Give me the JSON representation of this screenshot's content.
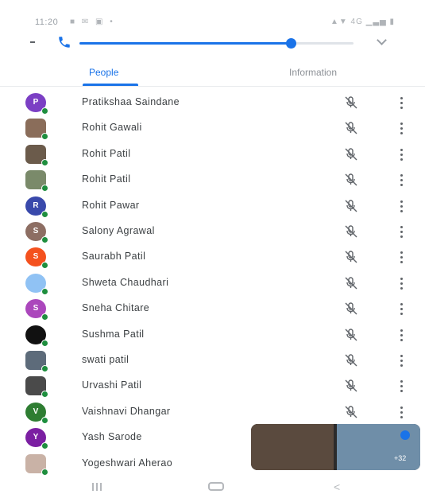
{
  "status_bar": {
    "time": "11:20",
    "left_icons": "■ ✉ ▣ •",
    "right": "▲▼ 4G ▁▃▅ ▮"
  },
  "call": {
    "progress": 0.77
  },
  "tabs": [
    {
      "label": "People",
      "active": true
    },
    {
      "label": "Information",
      "active": false
    }
  ],
  "participants": [
    {
      "name": "Pratikshaa Saindane",
      "avatar": {
        "type": "initial",
        "letter": "P",
        "color": "#7b3fc4"
      }
    },
    {
      "name": "Rohit Gawali",
      "avatar": {
        "type": "photo",
        "color": "#8a6d5a"
      }
    },
    {
      "name": "Rohit Patil",
      "avatar": {
        "type": "photo",
        "color": "#6b5b4b"
      }
    },
    {
      "name": "Rohit Patil",
      "avatar": {
        "type": "photo",
        "color": "#7a8a6a"
      }
    },
    {
      "name": "Rohit Pawar",
      "avatar": {
        "type": "initial",
        "letter": "R",
        "color": "#3949ab"
      }
    },
    {
      "name": "Salony Agrawal",
      "avatar": {
        "type": "initial",
        "letter": "S",
        "color": "#8d6e63"
      }
    },
    {
      "name": "Saurabh Patil",
      "avatar": {
        "type": "initial",
        "letter": "S",
        "color": "#f4511e"
      }
    },
    {
      "name": "Shweta Chaudhari",
      "avatar": {
        "type": "initial",
        "letter": "",
        "color": "#90c2f4"
      }
    },
    {
      "name": "Sneha Chitare",
      "avatar": {
        "type": "initial",
        "letter": "S",
        "color": "#ab47bc"
      }
    },
    {
      "name": "Sushma Patil",
      "avatar": {
        "type": "initial",
        "letter": "",
        "color": "#111111"
      }
    },
    {
      "name": "swati patil",
      "avatar": {
        "type": "photo",
        "color": "#5d6b7a"
      }
    },
    {
      "name": "Urvashi Patil",
      "avatar": {
        "type": "photo",
        "color": "#4a4a4a"
      }
    },
    {
      "name": "Vaishnavi Dhangar",
      "avatar": {
        "type": "initial",
        "letter": "V",
        "color": "#2e7d32"
      }
    },
    {
      "name": "Yash Sarode",
      "avatar": {
        "type": "initial",
        "letter": "Y",
        "color": "#7b1fa2"
      }
    },
    {
      "name": "Yogeshwari Aherao",
      "avatar": {
        "type": "photo",
        "color": "#c9b2a6"
      }
    }
  ],
  "pip": {
    "tiles": [
      {
        "color": "#5a4a3e"
      },
      {
        "color": "#6f8ea8"
      }
    ],
    "badge": "+32"
  },
  "colors": {
    "accent": "#1a73e8",
    "online": "#1e8e3e"
  },
  "icons": {
    "participant_mic": "mic-off-icon",
    "participant_menu": "more-vert-icon",
    "call": "phone-icon"
  }
}
